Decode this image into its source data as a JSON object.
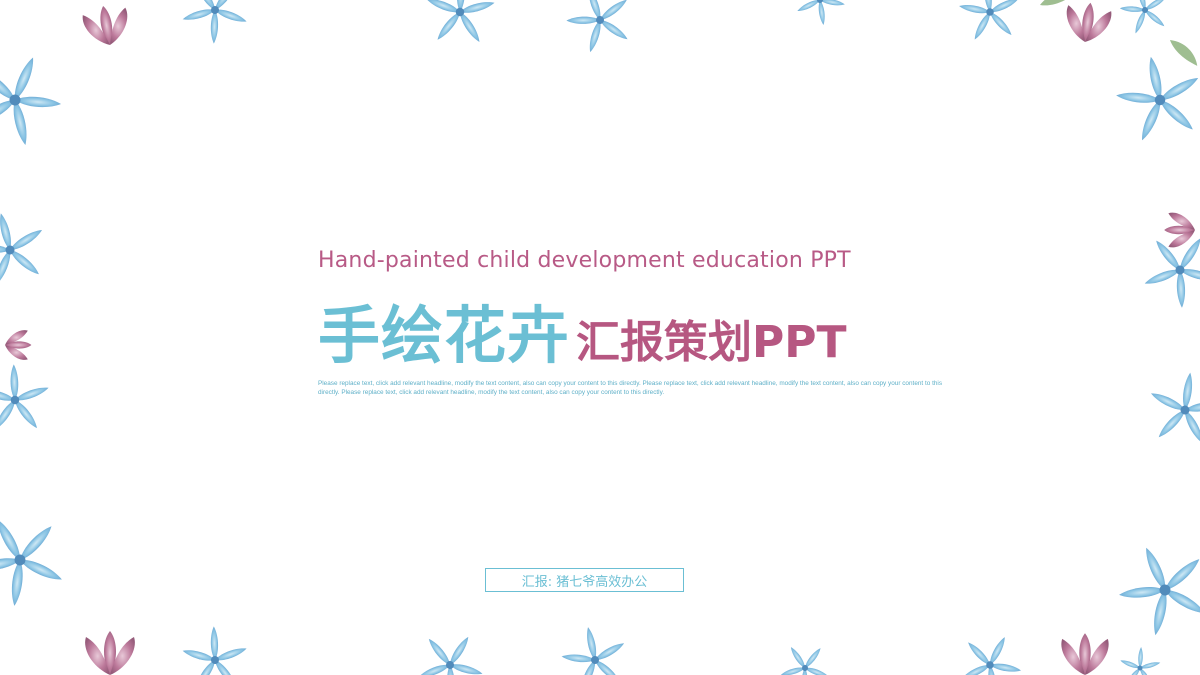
{
  "slide": {
    "subtitle_en": "Hand-painted child development education PPT",
    "title_main": "手绘花卉",
    "title_sub": "汇报策划PPT",
    "description": "Please replace text, click add relevant headline, modify the text content, also can copy your content to this directly. Please replace text, click add relevant headline, modify the text content, also can copy your content to this directly. Please replace text, click add relevant headline, modify the text content, also can copy your content to this directly.",
    "reporter": "汇报: 猪七爷高效办公"
  },
  "colors": {
    "accent_blue": "#6bbfd4",
    "accent_pink": "#b65781",
    "flower_blue": "#5ea8d2",
    "flower_pink": "#b05a82"
  },
  "decor": {
    "frame": "watercolor-flower-border"
  }
}
